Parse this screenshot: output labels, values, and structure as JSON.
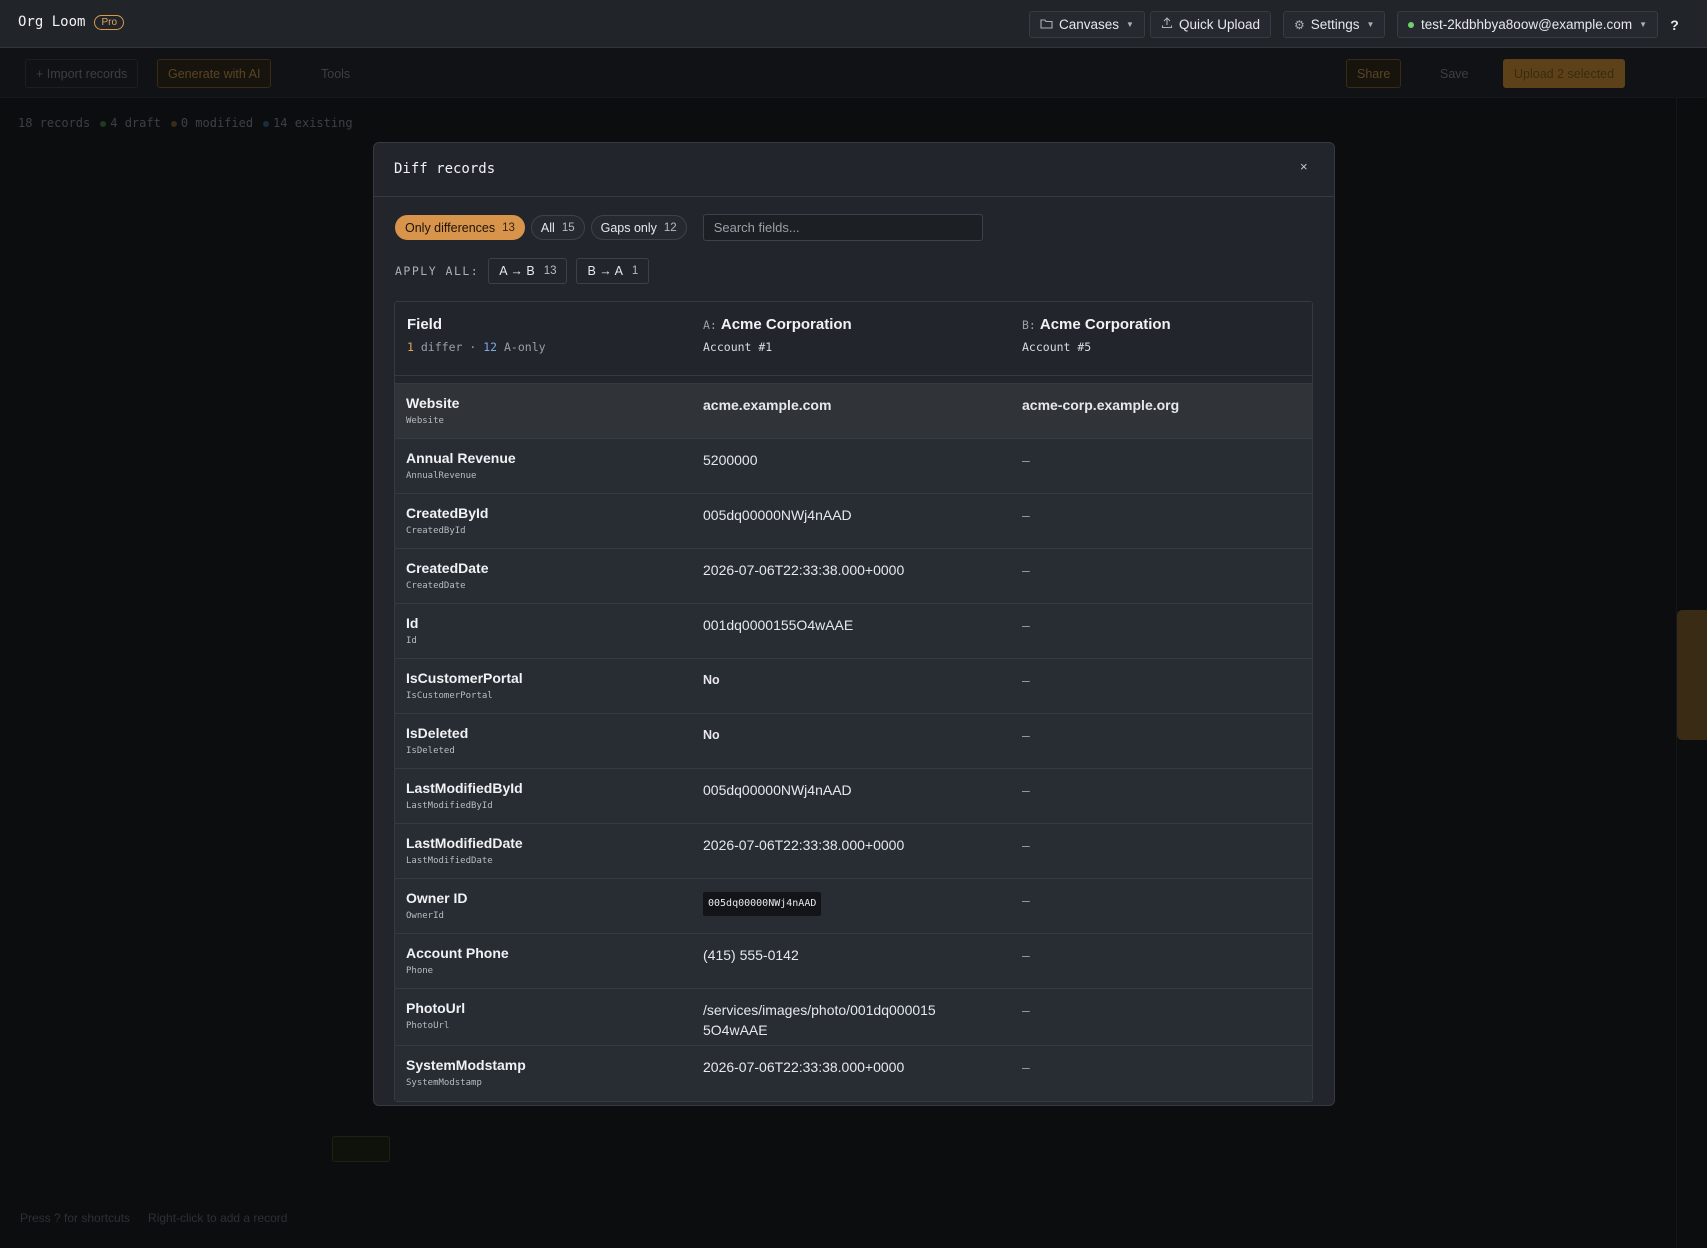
{
  "app": {
    "name": "Org Loom",
    "badge": "Pro"
  },
  "topbar": {
    "canvases": "Canvases",
    "quick_upload": "Quick Upload",
    "settings": "Settings",
    "user_email": "test-2kdbhbya8oow@example.com",
    "help": "?"
  },
  "background": {
    "import_records": "+ Import records",
    "generate_ai": "Generate with AI",
    "tools": "Tools",
    "share": "Share",
    "save": "Save",
    "upload_selected": "Upload 2 selected",
    "stats": {
      "records": "18 records",
      "draft": "4 draft",
      "modified": "0 modified",
      "existing": "14 existing"
    },
    "footer_shortcuts": "Press ? for shortcuts",
    "footer_hint": "Right-click to add a record"
  },
  "modal": {
    "title": "Diff records",
    "close": "×",
    "filters": [
      {
        "label": "Only differences",
        "count": "13"
      },
      {
        "label": "All",
        "count": "15"
      },
      {
        "label": "Gaps only",
        "count": "12"
      }
    ],
    "search_placeholder": "Search fields...",
    "apply_all_label": "APPLY ALL:",
    "apply_a_to_b": {
      "label": "A → B",
      "count": "13"
    },
    "apply_b_to_a": {
      "label": "B → A",
      "count": "1"
    },
    "table": {
      "field_header": "Field",
      "differ_count": "1",
      "differ_text": "differ ·",
      "aonly_count": "12",
      "aonly_text": "A-only",
      "a_prefix": "A:",
      "a_name": "Acme Corporation",
      "a_account": "Account #1",
      "b_prefix": "B:",
      "b_name": "Acme Corporation",
      "b_account": "Account #5"
    },
    "rows": [
      {
        "label": "Website",
        "api": "Website",
        "a": "acme.example.com",
        "b": "acme-corp.example.org"
      },
      {
        "label": "Annual Revenue",
        "api": "AnnualRevenue",
        "a": "5200000",
        "b": "–"
      },
      {
        "label": "CreatedById",
        "api": "CreatedById",
        "a": "005dq00000NWj4nAAD",
        "b": "–"
      },
      {
        "label": "CreatedDate",
        "api": "CreatedDate",
        "a": "2026-07-06T22:33:38.000+0000",
        "b": "–"
      },
      {
        "label": "Id",
        "api": "Id",
        "a": "001dq0000155O4wAAE",
        "b": "–"
      },
      {
        "label": "IsCustomerPortal",
        "api": "IsCustomerPortal",
        "a": "No",
        "b": "–"
      },
      {
        "label": "IsDeleted",
        "api": "IsDeleted",
        "a": "No",
        "b": "–"
      },
      {
        "label": "LastModifiedById",
        "api": "LastModifiedById",
        "a": "005dq00000NWj4nAAD",
        "b": "–"
      },
      {
        "label": "LastModifiedDate",
        "api": "LastModifiedDate",
        "a": "2026-07-06T22:33:38.000+0000",
        "b": "–"
      },
      {
        "label": "Owner ID",
        "api": "OwnerId",
        "a": "005dq00000NWj4nAAD",
        "b": "–"
      },
      {
        "label": "Account Phone",
        "api": "Phone",
        "a": "(415) 555-0142",
        "b": "–"
      },
      {
        "label": "PhotoUrl",
        "api": "PhotoUrl",
        "a": "/services/images/photo/001dq0000155O4wAAE",
        "b": "–"
      },
      {
        "label": "SystemModstamp",
        "api": "SystemModstamp",
        "a": "2026-07-06T22:33:38.000+0000",
        "b": "–"
      }
    ]
  }
}
